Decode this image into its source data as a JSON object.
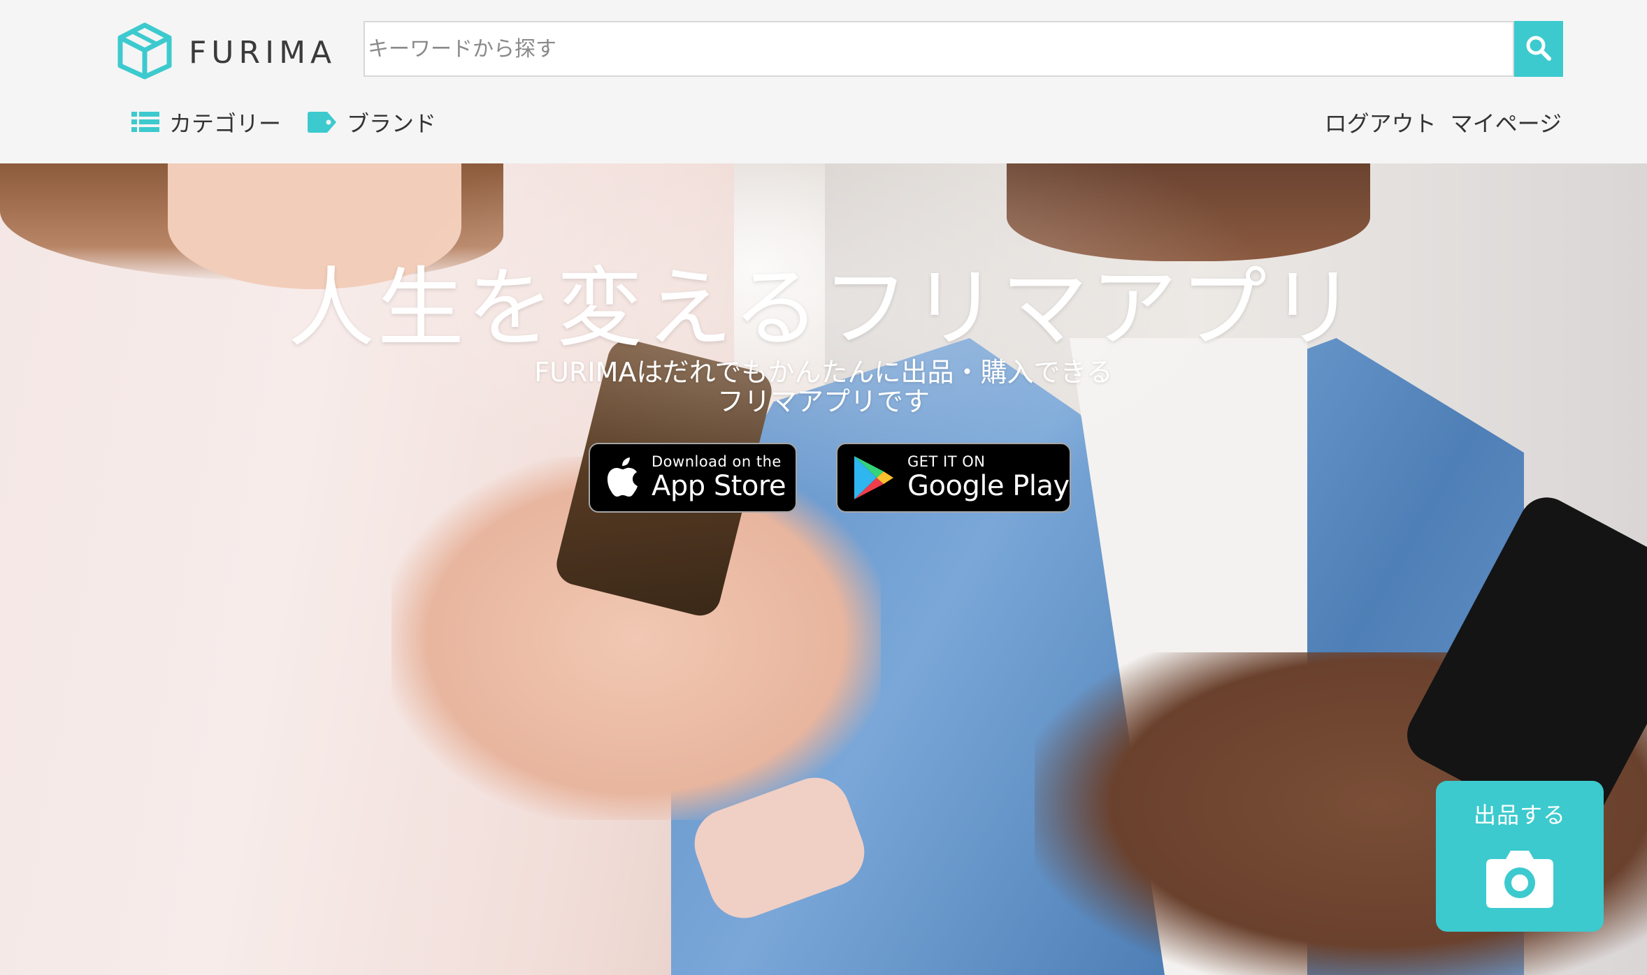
{
  "header": {
    "logo_text": "FURIMA",
    "search": {
      "placeholder": "キーワードから探す"
    },
    "search_button_icon": "search-icon",
    "nav_left": [
      {
        "label": "カテゴリー",
        "icon": "list-icon"
      },
      {
        "label": "ブランド",
        "icon": "tag-icon"
      }
    ],
    "nav_right": [
      {
        "label": "ログアウト"
      },
      {
        "label": "マイページ"
      }
    ]
  },
  "hero": {
    "title": "人生を変えるフリマアプリ",
    "subtitle_line1": "FURIMAはだれでもかんたんに出品・購入できる",
    "subtitle_line2": "フリマアプリです",
    "app_store": {
      "small": "Download on the",
      "big": "App Store",
      "icon": "apple-icon"
    },
    "google_play": {
      "small": "GET IT ON",
      "big": "Google Play",
      "icon": "google-play-icon"
    }
  },
  "sell_button": {
    "label": "出品する",
    "icon": "camera-icon"
  },
  "colors": {
    "accent": "#3ccace",
    "text": "#333333",
    "header_bg": "#f5f5f5"
  }
}
